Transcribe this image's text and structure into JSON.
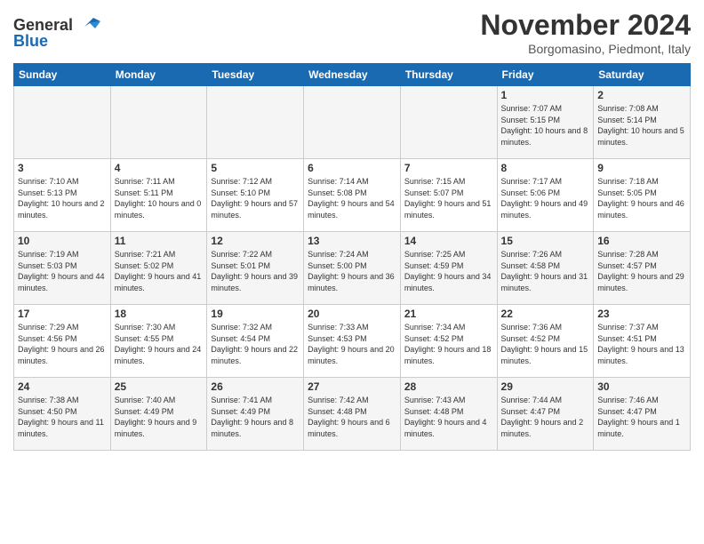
{
  "logo": {
    "line1": "General",
    "line2": "Blue"
  },
  "title": "November 2024",
  "subtitle": "Borgomasino, Piedmont, Italy",
  "days_of_week": [
    "Sunday",
    "Monday",
    "Tuesday",
    "Wednesday",
    "Thursday",
    "Friday",
    "Saturday"
  ],
  "weeks": [
    [
      {
        "day": "",
        "info": ""
      },
      {
        "day": "",
        "info": ""
      },
      {
        "day": "",
        "info": ""
      },
      {
        "day": "",
        "info": ""
      },
      {
        "day": "",
        "info": ""
      },
      {
        "day": "1",
        "info": "Sunrise: 7:07 AM\nSunset: 5:15 PM\nDaylight: 10 hours and 8 minutes."
      },
      {
        "day": "2",
        "info": "Sunrise: 7:08 AM\nSunset: 5:14 PM\nDaylight: 10 hours and 5 minutes."
      }
    ],
    [
      {
        "day": "3",
        "info": "Sunrise: 7:10 AM\nSunset: 5:13 PM\nDaylight: 10 hours and 2 minutes."
      },
      {
        "day": "4",
        "info": "Sunrise: 7:11 AM\nSunset: 5:11 PM\nDaylight: 10 hours and 0 minutes."
      },
      {
        "day": "5",
        "info": "Sunrise: 7:12 AM\nSunset: 5:10 PM\nDaylight: 9 hours and 57 minutes."
      },
      {
        "day": "6",
        "info": "Sunrise: 7:14 AM\nSunset: 5:08 PM\nDaylight: 9 hours and 54 minutes."
      },
      {
        "day": "7",
        "info": "Sunrise: 7:15 AM\nSunset: 5:07 PM\nDaylight: 9 hours and 51 minutes."
      },
      {
        "day": "8",
        "info": "Sunrise: 7:17 AM\nSunset: 5:06 PM\nDaylight: 9 hours and 49 minutes."
      },
      {
        "day": "9",
        "info": "Sunrise: 7:18 AM\nSunset: 5:05 PM\nDaylight: 9 hours and 46 minutes."
      }
    ],
    [
      {
        "day": "10",
        "info": "Sunrise: 7:19 AM\nSunset: 5:03 PM\nDaylight: 9 hours and 44 minutes."
      },
      {
        "day": "11",
        "info": "Sunrise: 7:21 AM\nSunset: 5:02 PM\nDaylight: 9 hours and 41 minutes."
      },
      {
        "day": "12",
        "info": "Sunrise: 7:22 AM\nSunset: 5:01 PM\nDaylight: 9 hours and 39 minutes."
      },
      {
        "day": "13",
        "info": "Sunrise: 7:24 AM\nSunset: 5:00 PM\nDaylight: 9 hours and 36 minutes."
      },
      {
        "day": "14",
        "info": "Sunrise: 7:25 AM\nSunset: 4:59 PM\nDaylight: 9 hours and 34 minutes."
      },
      {
        "day": "15",
        "info": "Sunrise: 7:26 AM\nSunset: 4:58 PM\nDaylight: 9 hours and 31 minutes."
      },
      {
        "day": "16",
        "info": "Sunrise: 7:28 AM\nSunset: 4:57 PM\nDaylight: 9 hours and 29 minutes."
      }
    ],
    [
      {
        "day": "17",
        "info": "Sunrise: 7:29 AM\nSunset: 4:56 PM\nDaylight: 9 hours and 26 minutes."
      },
      {
        "day": "18",
        "info": "Sunrise: 7:30 AM\nSunset: 4:55 PM\nDaylight: 9 hours and 24 minutes."
      },
      {
        "day": "19",
        "info": "Sunrise: 7:32 AM\nSunset: 4:54 PM\nDaylight: 9 hours and 22 minutes."
      },
      {
        "day": "20",
        "info": "Sunrise: 7:33 AM\nSunset: 4:53 PM\nDaylight: 9 hours and 20 minutes."
      },
      {
        "day": "21",
        "info": "Sunrise: 7:34 AM\nSunset: 4:52 PM\nDaylight: 9 hours and 18 minutes."
      },
      {
        "day": "22",
        "info": "Sunrise: 7:36 AM\nSunset: 4:52 PM\nDaylight: 9 hours and 15 minutes."
      },
      {
        "day": "23",
        "info": "Sunrise: 7:37 AM\nSunset: 4:51 PM\nDaylight: 9 hours and 13 minutes."
      }
    ],
    [
      {
        "day": "24",
        "info": "Sunrise: 7:38 AM\nSunset: 4:50 PM\nDaylight: 9 hours and 11 minutes."
      },
      {
        "day": "25",
        "info": "Sunrise: 7:40 AM\nSunset: 4:49 PM\nDaylight: 9 hours and 9 minutes."
      },
      {
        "day": "26",
        "info": "Sunrise: 7:41 AM\nSunset: 4:49 PM\nDaylight: 9 hours and 8 minutes."
      },
      {
        "day": "27",
        "info": "Sunrise: 7:42 AM\nSunset: 4:48 PM\nDaylight: 9 hours and 6 minutes."
      },
      {
        "day": "28",
        "info": "Sunrise: 7:43 AM\nSunset: 4:48 PM\nDaylight: 9 hours and 4 minutes."
      },
      {
        "day": "29",
        "info": "Sunrise: 7:44 AM\nSunset: 4:47 PM\nDaylight: 9 hours and 2 minutes."
      },
      {
        "day": "30",
        "info": "Sunrise: 7:46 AM\nSunset: 4:47 PM\nDaylight: 9 hours and 1 minute."
      }
    ]
  ]
}
